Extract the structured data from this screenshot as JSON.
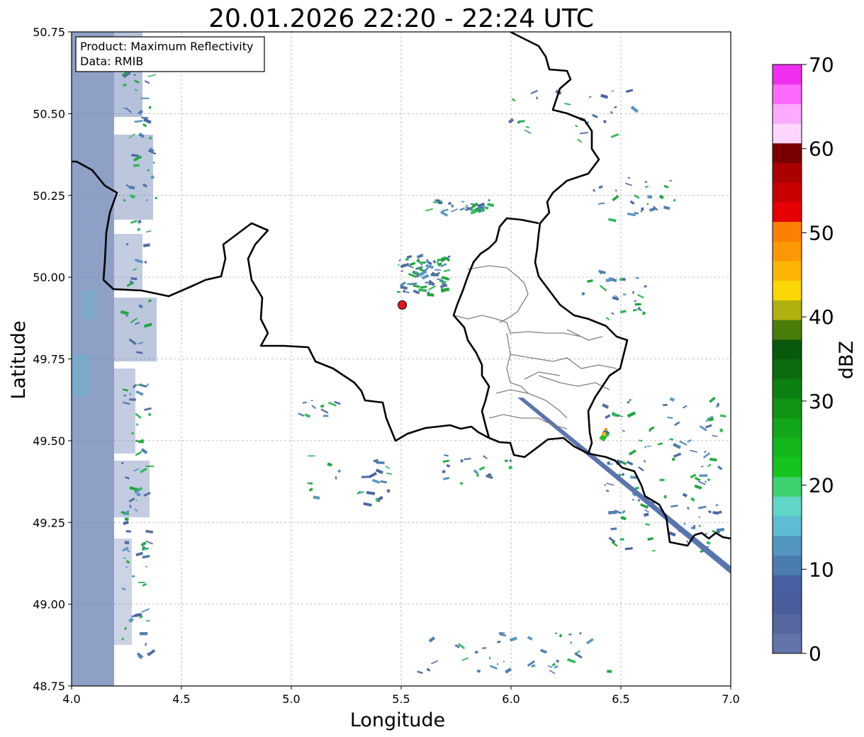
{
  "title": "20.01.2026 22:20 - 22:24 UTC",
  "info": {
    "product_line": "Product: Maximum Reflectivity",
    "data_line": "Data: RMIB"
  },
  "axes": {
    "xlabel": "Longitude",
    "ylabel": "Latitude",
    "x_ticks": [
      "4.0",
      "4.5",
      "5.0",
      "5.5",
      "6.0",
      "6.5",
      "7.0"
    ],
    "y_ticks": [
      "50.75",
      "50.50",
      "50.25",
      "50.00",
      "49.75",
      "49.50",
      "49.25",
      "49.00",
      "48.75"
    ],
    "xlim": [
      4.0,
      7.0
    ],
    "ylim": [
      48.75,
      50.75
    ]
  },
  "radar_site": {
    "lon": 5.505,
    "lat": 49.915,
    "color": "#e8141e"
  },
  "colorbar": {
    "label": "dBZ",
    "ticks": [
      "0",
      "10",
      "20",
      "30",
      "40",
      "50",
      "60",
      "70"
    ],
    "range": [
      0,
      70
    ],
    "colors": [
      "#6474a8",
      "#56679f",
      "#4a5e9e",
      "#4660a2",
      "#4a7cb0",
      "#5296c0",
      "#5ebcd4",
      "#60d6c6",
      "#3ed26e",
      "#16c41e",
      "#14b81c",
      "#12a61a",
      "#109414",
      "#0c8010",
      "#0a6c0e",
      "#085a0a",
      "#4a7c0a",
      "#b0b00e",
      "#fad606",
      "#fcb406",
      "#fc9806",
      "#fc7e04",
      "#e60004",
      "#c80002",
      "#aa0000",
      "#780000",
      "#fcd6fc",
      "#fcaafc",
      "#fc6afc",
      "#f030f0"
    ]
  }
}
